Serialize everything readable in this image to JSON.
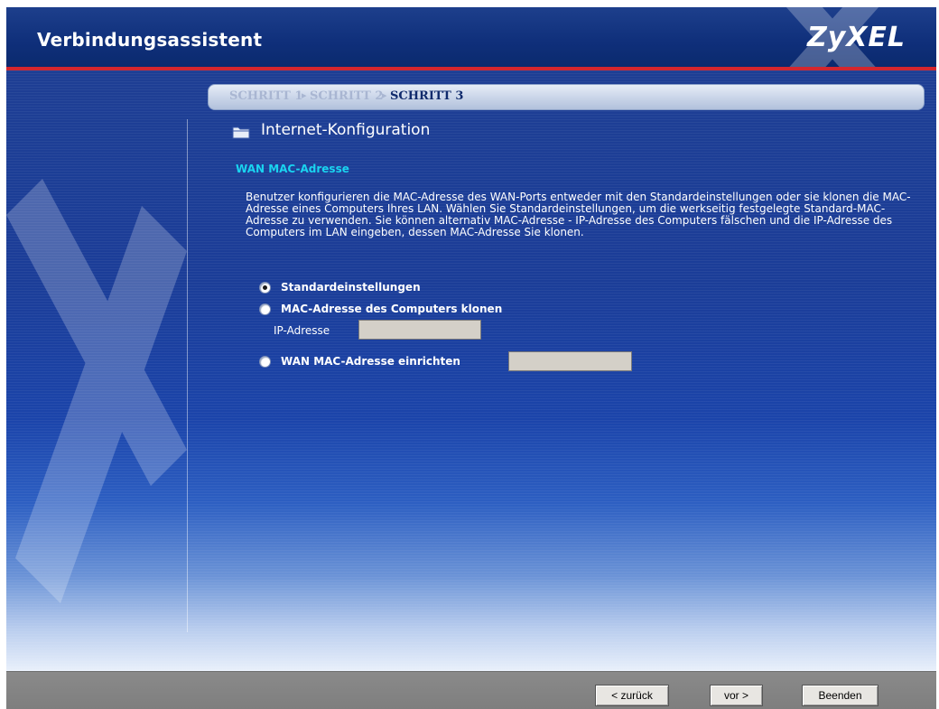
{
  "header": {
    "title": "Verbindungsassistent",
    "brand": "ZyXEL"
  },
  "steps": [
    {
      "label": "SCHRITT 1",
      "state": "inactive"
    },
    {
      "label": "SCHRITT 2",
      "state": "inactive"
    },
    {
      "label": "SCHRITT 3",
      "state": "active"
    }
  ],
  "section": {
    "title": "Internet-Konfiguration",
    "icon": "folder-icon"
  },
  "wan_mac": {
    "heading": "WAN MAC-Adresse",
    "description": "Benutzer konfigurieren die MAC-Adresse des WAN-Ports entweder mit den Standardeinstellungen oder sie klonen die MAC-Adresse eines Computers Ihres LAN. Wählen Sie Standardeinstellungen, um die werkseitig festgelegte Standard-MAC-Adresse zu verwenden. Sie können alternativ MAC-Adresse - IP-Adresse des Computers fälschen und die IP-Adresse des Computers im LAN eingeben, dessen MAC-Adresse Sie klonen.",
    "options": [
      {
        "label": "Standardeinstellungen",
        "selected": true
      },
      {
        "label": "MAC-Adresse des Computers klonen",
        "selected": false
      },
      {
        "label": "WAN MAC-Adresse einrichten",
        "selected": false
      }
    ],
    "ip_label": "IP-Adresse",
    "ip_value": "",
    "mac_value": ""
  },
  "footer": {
    "back": "< zurück",
    "next": "vor >",
    "finish": "Beenden"
  },
  "colors": {
    "header_bg": "#0f2f7a",
    "accent_red": "#d4262e",
    "heading_cyan": "#19d4f0",
    "footer_bg": "#808080"
  }
}
